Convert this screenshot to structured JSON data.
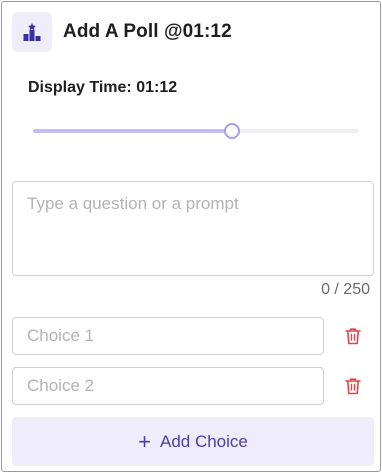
{
  "header": {
    "title": "Add A Poll @01:12",
    "icon": "poll-podium-icon"
  },
  "display_time": {
    "label": "Display Time: 01:12",
    "slider_fraction": 0.61
  },
  "question": {
    "placeholder": "Type a question or a prompt",
    "value": "",
    "counter": "0 / 250"
  },
  "choices": [
    {
      "placeholder": "Choice 1",
      "value": ""
    },
    {
      "placeholder": "Choice 2",
      "value": ""
    }
  ],
  "add_choice": {
    "label": "Add Choice"
  },
  "colors": {
    "accent": "#4a3da8",
    "accent_light": "#efedfb",
    "slider_fill": "#c5bdf0",
    "delete": "#e0464b"
  }
}
